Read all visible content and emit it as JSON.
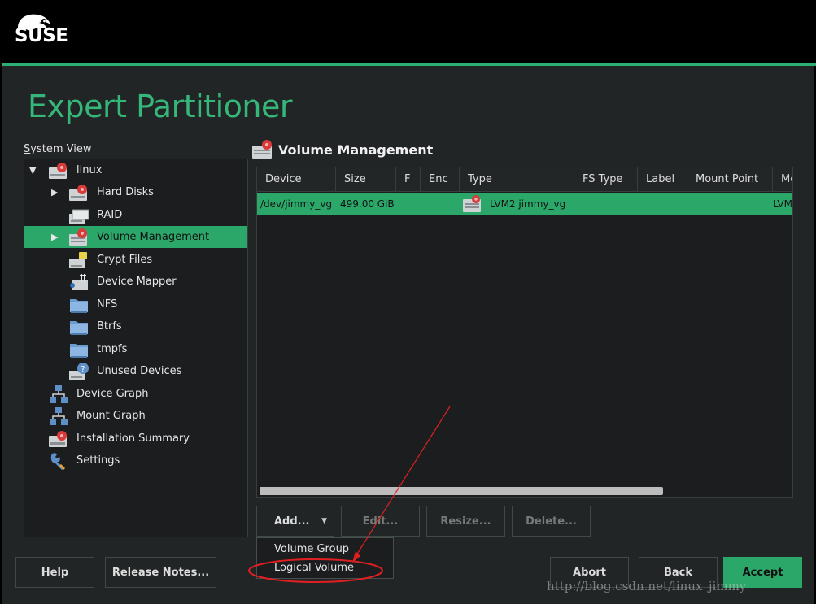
{
  "brand": {
    "logo_text": "SUSE"
  },
  "page_title": "Expert Partitioner",
  "system_view": {
    "label_prefix": "S",
    "label_rest": "ystem View",
    "items": [
      {
        "label": "linux",
        "icon": "disk-icon",
        "expander": "expanded"
      },
      {
        "label": "Hard Disks",
        "icon": "hard-disk-icon",
        "expander": "collapsed"
      },
      {
        "label": "RAID",
        "icon": "raid-icon",
        "expander": "none"
      },
      {
        "label": "Volume Management",
        "icon": "volume-management-icon",
        "expander": "collapsed",
        "selected": true
      },
      {
        "label": "Crypt Files",
        "icon": "crypt-files-icon",
        "expander": "none"
      },
      {
        "label": "Device Mapper",
        "icon": "device-mapper-icon",
        "expander": "none"
      },
      {
        "label": "NFS",
        "icon": "folder-icon",
        "expander": "none"
      },
      {
        "label": "Btrfs",
        "icon": "folder-icon",
        "expander": "none"
      },
      {
        "label": "tmpfs",
        "icon": "folder-icon",
        "expander": "none"
      },
      {
        "label": "Unused Devices",
        "icon": "unused-devices-icon",
        "expander": "none"
      },
      {
        "label": "Device Graph",
        "icon": "graph-icon",
        "expander": "none"
      },
      {
        "label": "Mount Graph",
        "icon": "graph-icon",
        "expander": "none"
      },
      {
        "label": "Installation Summary",
        "icon": "summary-icon",
        "expander": "none"
      },
      {
        "label": "Settings",
        "icon": "wrench-icon",
        "expander": "none"
      }
    ]
  },
  "volume_management": {
    "title": "Volume Management",
    "columns": [
      "Device",
      "Size",
      "F",
      "Enc",
      "Type",
      "FS Type",
      "Label",
      "Mount Point",
      "Me"
    ],
    "rows": [
      {
        "device": "/dev/jimmy_vg",
        "size": "499.00 GiB",
        "f": "",
        "enc": "",
        "type": "LVM2 jimmy_vg",
        "fs_type": "",
        "label": "",
        "mount_point": "",
        "me": "LVM"
      }
    ]
  },
  "actions": {
    "add": "Add...",
    "edit": "Edit...",
    "resize": "Resize...",
    "delete": "Delete..."
  },
  "add_menu": {
    "items": [
      "Volume Group",
      "Logical Volume"
    ]
  },
  "footer": {
    "help": "Help",
    "release_notes": "Release Notes...",
    "abort": "Abort",
    "back": "Back",
    "accept": "Accept"
  },
  "watermark": "http://blog.csdn.net/linux_jimmy",
  "colors": {
    "accent": "#2ca76a",
    "title": "#35b779",
    "annotation": "#e02020"
  }
}
